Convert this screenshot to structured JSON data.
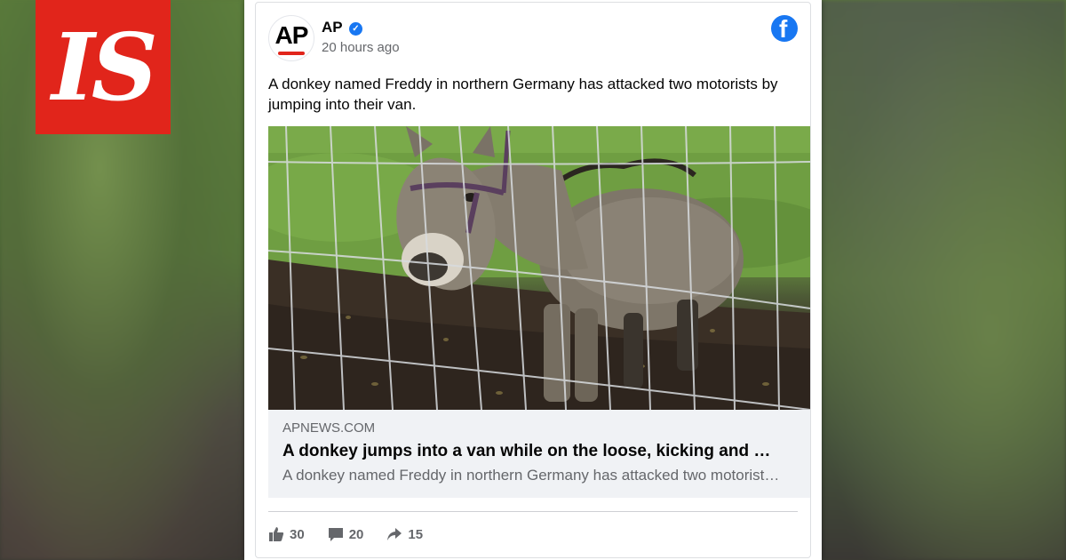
{
  "brand": {
    "logo_text": "IS",
    "logo_color": "#e1251b"
  },
  "post": {
    "page_name": "AP",
    "avatar_text": "AP",
    "verified": true,
    "timestamp": "20 hours ago",
    "text": "A donkey named Freddy in northern Germany has attacked two motorists by jumping into their van.",
    "platform_icon": "facebook-icon",
    "accent_color": "#1877f2"
  },
  "link_preview": {
    "domain": "APNEWS.COM",
    "title": "A donkey jumps into a van while on the loose, kicking and …",
    "description": "A donkey named Freddy in northern Germany has attacked two motorist…"
  },
  "engagement": {
    "likes": "30",
    "comments": "20",
    "shares": "15"
  }
}
